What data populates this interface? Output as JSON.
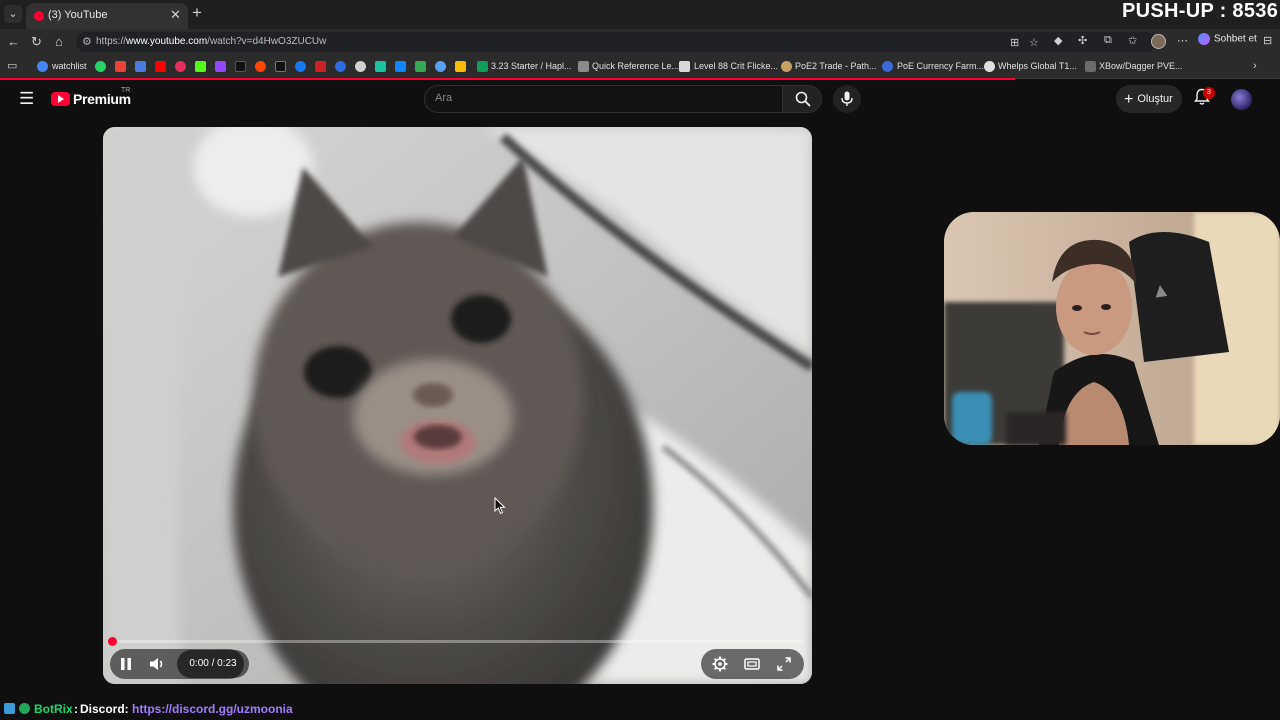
{
  "browser": {
    "tab_title": "(3) YouTube",
    "tab_close": "✕",
    "new_tab": "+",
    "url_prefix": "https://",
    "url_domain": "www.youtube.com",
    "url_path": "/watch?v=d4HwO3ZUCUw",
    "chat_button": "Sohbet et"
  },
  "stream_overlay": {
    "pushup_counter": "PUSH-UP : 8536"
  },
  "bookmarks": [
    {
      "label": "watchlist",
      "icon": "google-g-icon",
      "color": "#4285f4"
    },
    {
      "label": "3.23 Starter / Hapl...",
      "icon": "sheets-icon",
      "color": "#0f9d58"
    },
    {
      "label": "Quick Reference Le...",
      "icon": "document-icon",
      "color": "#8a8a8a"
    },
    {
      "label": "Level 88 Crit Flicke...",
      "icon": "document-icon",
      "color": "#d8d8d8"
    },
    {
      "label": "PoE2 Trade - Path...",
      "icon": "poe-icon",
      "color": "#c8a060"
    },
    {
      "label": "PoE Currency Farm...",
      "icon": "globe-icon",
      "color": "#3b6bd6"
    },
    {
      "label": "Whelps Global T1...",
      "icon": "github-icon",
      "color": "#e0e0e0"
    },
    {
      "label": "XBow/Dagger PVE...",
      "icon": "doc-icon",
      "color": "#6a6a6a"
    }
  ],
  "youtube": {
    "brand": "Premium",
    "region": "TR",
    "search_placeholder": "Ara",
    "create_label": "Oluştur",
    "notification_count": "3"
  },
  "player": {
    "current_time": "0:00",
    "duration": "0:23",
    "time_display": "0:00 / 0:23",
    "progress": 0.0,
    "state": "playing"
  },
  "chat": {
    "username": "BotRix",
    "separator": ":",
    "message": "Discord:",
    "link": "https://discord.gg/uzmoonia"
  }
}
